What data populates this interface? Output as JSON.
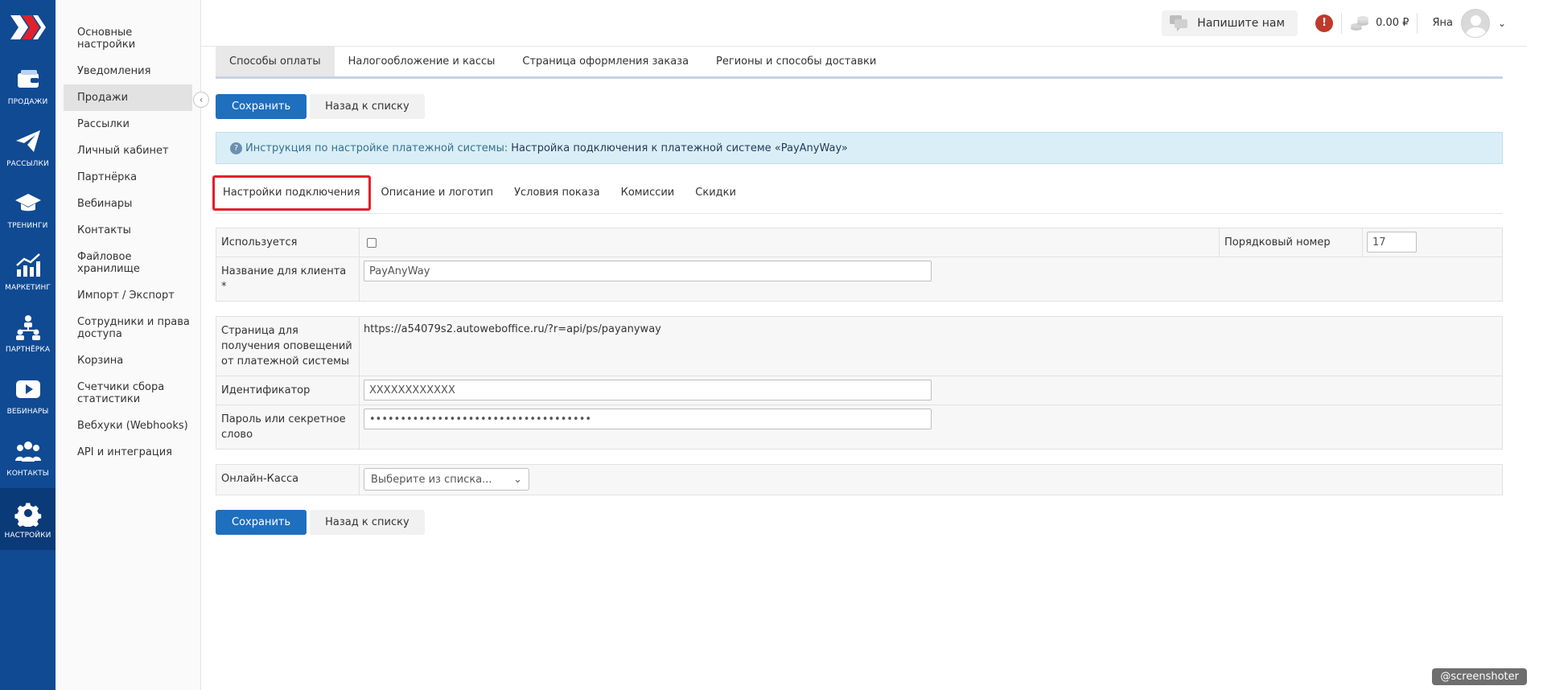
{
  "rail": {
    "items": [
      {
        "label": "ПРОДАЖИ",
        "icon": "wallet-icon"
      },
      {
        "label": "РАССЫЛКИ",
        "icon": "paper-plane-icon"
      },
      {
        "label": "ТРЕНИНГИ",
        "icon": "graduation-cap-icon"
      },
      {
        "label": "МАРКЕТИНГ",
        "icon": "chart-up-icon"
      },
      {
        "label": "ПАРТНЁРКА",
        "icon": "org-structure-icon"
      },
      {
        "label": "ВЕБИНАРЫ",
        "icon": "play-icon"
      },
      {
        "label": "КОНТАКТЫ",
        "icon": "users-icon"
      },
      {
        "label": "НАСТРОЙКИ",
        "icon": "gear-icon"
      }
    ]
  },
  "menu": {
    "items": [
      "Основные настройки",
      "Уведомления",
      "Продажи",
      "Рассылки",
      "Личный кабинет",
      "Партнёрка",
      "Вебинары",
      "Контакты",
      "Файловое хранилище",
      "Импорт / Экспорт",
      "Сотрудники и права доступа",
      "Корзина",
      "Счетчики сбора статистики",
      "Вебхуки (Webhooks)",
      "API и интеграция"
    ],
    "active": "Продажи"
  },
  "topbar": {
    "write_us": "Напишите нам",
    "alert": "!",
    "balance": "0.00 ₽",
    "user_name": "Яна"
  },
  "tabs_top": [
    "Способы оплаты",
    "Налогообложение и кассы",
    "Страница оформления заказа",
    "Регионы и способы доставки"
  ],
  "actions": {
    "save": "Сохранить",
    "back": "Назад к списку"
  },
  "info": {
    "icon_text": "?",
    "lead": "Инструкция по настройке платежной системы:",
    "link": "Настройка подключения к платежной системе «PayAnyWay»"
  },
  "subtabs": [
    "Настройки подключения",
    "Описание и логотип",
    "Условия показа",
    "Комиссии",
    "Скидки"
  ],
  "form": {
    "used_label": "Используется",
    "order_label": "Порядковый номер",
    "order_value": "17",
    "client_name_label": "Название для клиента *",
    "client_name_value": "PayAnyWay",
    "notify_label": "Страница для получения оповещений от платежной системы",
    "notify_value": "https://a54079s2.autoweboffice.ru/?r=api/ps/payanyway",
    "id_label": "Идентификатор",
    "id_value": "XXXXXXXXXXXX",
    "password_label": "Пароль или секретное слово",
    "password_value": "••••••••••••••••••••••••••••••••••••",
    "kassa_label": "Онлайн-Касса",
    "kassa_value": "Выберите из списка..."
  },
  "watermark": "@screenshoter",
  "colors": {
    "rail": "#0f4a93",
    "primary": "#1f6fbf",
    "highlight": "#e0212a",
    "info_bg": "#d9eef6"
  }
}
